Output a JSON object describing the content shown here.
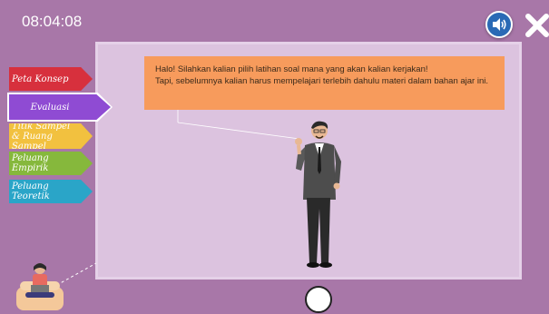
{
  "header": {
    "timer": "08:04:08",
    "sound_icon": "speaker-icon",
    "close_icon": "close-icon"
  },
  "nav": {
    "items": [
      {
        "label": "Peta Konsep",
        "color": "#d7303d"
      },
      {
        "label": "Evaluasi",
        "color": "#8f4bd3",
        "active": true
      },
      {
        "label": "Titik Sampel & Ruang Sampel",
        "color": "#f2c13f"
      },
      {
        "label": "Peluang Empirik",
        "color": "#86b83c"
      },
      {
        "label": "Peluang Teoretik",
        "color": "#2aa5c8"
      }
    ]
  },
  "speech": {
    "line1": "Halo! Silahkan kalian pilih latihan soal mana yang akan kalian kerjakan!",
    "line2": "Tapi, sebelumnya kalian harus mempelajari terlebih dahulu materi dalam bahan ajar ini."
  },
  "colors": {
    "background": "#a877a8",
    "board": "#dcc3df",
    "speech_bubble": "#f79b5c",
    "sound_button": "#2a6ab5"
  }
}
